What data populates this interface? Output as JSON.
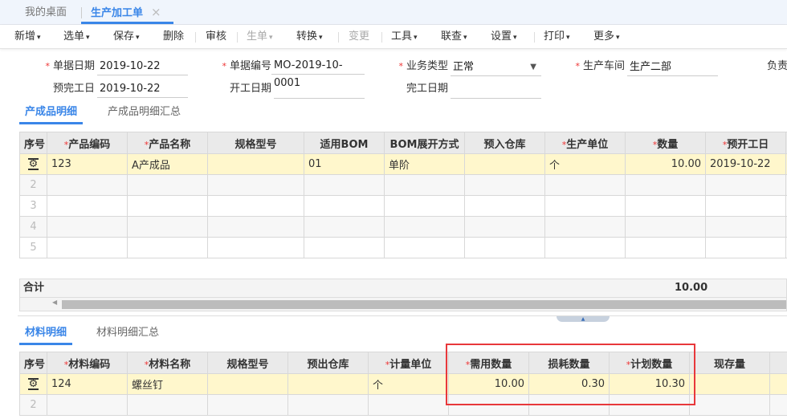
{
  "tabs": [
    {
      "label": "我的桌面"
    },
    {
      "label": "生产加工单",
      "close": "×"
    }
  ],
  "toolbar": [
    {
      "label": "新增",
      "chev": "▾"
    },
    {
      "label": "选单",
      "chev": "▾"
    },
    {
      "label": "保存",
      "chev": "▾"
    },
    {
      "label": "删除"
    },
    {
      "label": "审核"
    },
    {
      "label": "生单",
      "chev": "▾",
      "disabled": true
    },
    {
      "label": "转换",
      "chev": "▾"
    },
    {
      "label": "变更",
      "disabled": true
    },
    {
      "label": "工具",
      "chev": "▾"
    },
    {
      "label": "联查",
      "chev": "▾"
    },
    {
      "label": "设置",
      "chev": "▾"
    },
    {
      "label": "打印",
      "chev": "▾"
    },
    {
      "label": "更多",
      "chev": "▾"
    }
  ],
  "form": {
    "req": "*",
    "doc_date": {
      "label": "单据日期",
      "value": "2019-10-22"
    },
    "doc_no": {
      "label": "单据编号",
      "value": "MO-2019-10-0001"
    },
    "biz_type": {
      "label": "业务类型",
      "value": "正常"
    },
    "workshop": {
      "label": "生产车间",
      "value": "生产二部"
    },
    "owner": {
      "label": "负责"
    },
    "plan_finish": {
      "label": "预完工日",
      "value": "2019-10-22"
    },
    "start_date": {
      "label": "开工日期",
      "value": ""
    },
    "finish_date": {
      "label": "完工日期",
      "value": ""
    }
  },
  "product_tabs": [
    "产成品明细",
    "产成品明细汇总"
  ],
  "product_table": {
    "columns": [
      {
        "label": "序号"
      },
      {
        "label": "产品编码",
        "req": true
      },
      {
        "label": "产品名称",
        "req": true
      },
      {
        "label": "规格型号"
      },
      {
        "label": "适用BOM"
      },
      {
        "label": "BOM展开方式"
      },
      {
        "label": "预入仓库"
      },
      {
        "label": "生产单位",
        "req": true
      },
      {
        "label": "数量",
        "req": true
      },
      {
        "label": "预开工日",
        "req": true
      }
    ],
    "rows": [
      [
        "123",
        "A产成品",
        "",
        "01",
        "单阶",
        "",
        "个",
        "10.00",
        "2019-10-22"
      ]
    ],
    "empty_rows": [
      "2",
      "3",
      "4",
      "5"
    ],
    "total_label": "合计",
    "total_qty": "10.00"
  },
  "material_tabs": [
    "材料明细",
    "材料明细汇总"
  ],
  "material_table": {
    "columns": [
      {
        "label": "序号"
      },
      {
        "label": "材料编码",
        "req": true
      },
      {
        "label": "材料名称",
        "req": true
      },
      {
        "label": "规格型号"
      },
      {
        "label": "预出仓库"
      },
      {
        "label": "计量单位",
        "req": true
      },
      {
        "label": "需用数量",
        "req": true
      },
      {
        "label": "损耗数量"
      },
      {
        "label": "计划数量",
        "req": true
      },
      {
        "label": "现存量"
      }
    ],
    "rows": [
      [
        "124",
        "螺丝钉",
        "",
        "",
        "个",
        "10.00",
        "0.30",
        "10.30",
        ""
      ]
    ],
    "empty_rows": [
      "2"
    ]
  },
  "colors": {
    "accent": "#3a86e8",
    "required": "#e33333",
    "selected_row": "#fff7cc",
    "highlight_box": "#e8383b"
  }
}
